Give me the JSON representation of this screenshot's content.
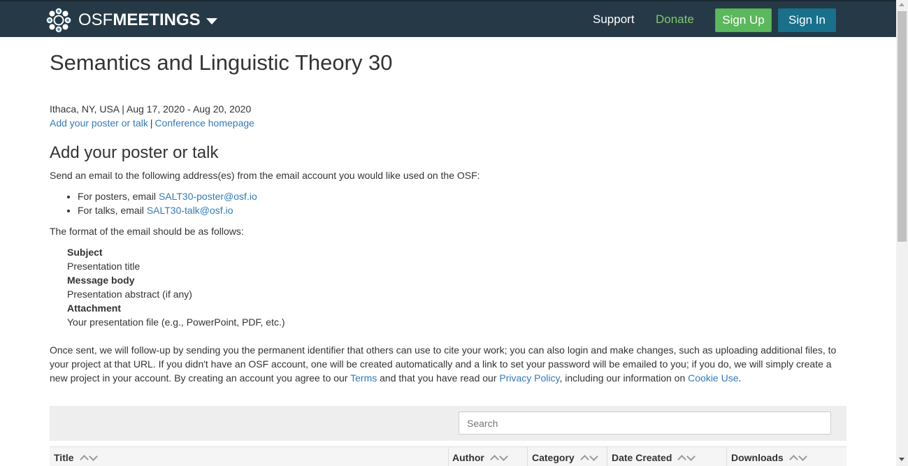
{
  "nav": {
    "brand_osf": "OSF",
    "brand_meetings": "MEETINGS",
    "brand_logo_icon": "osf-flower-logo-icon",
    "support": "Support",
    "donate": "Donate",
    "signup": "Sign Up",
    "signin": "Sign In",
    "colors": {
      "navbar": "#263947",
      "donate": "#7fcb68",
      "signup": "#5cb85c",
      "signin": "#18708b"
    }
  },
  "meeting": {
    "title": "Semantics and Linguistic Theory 30",
    "location_dates": "Ithaca, NY, USA | Aug 17, 2020 - Aug 20, 2020",
    "link_add": "Add your poster or talk",
    "link_sep": "|",
    "link_homepage": "Conference homepage"
  },
  "submit": {
    "heading": "Add your poster or talk",
    "intro": "Send an email to the following address(es) from the email account you would like used on the OSF:",
    "posters_prefix": "For posters, email ",
    "posters_email": "SALT30-poster@osf.io",
    "talks_prefix": "For talks, email ",
    "talks_email": "SALT30-talk@osf.io",
    "format_intro": "The format of the email should be as follows:",
    "subject_label": "Subject",
    "subject_value": "Presentation title",
    "body_label": "Message body",
    "body_value": "Presentation abstract (if any)",
    "attachment_label": "Attachment",
    "attachment_value": "Your presentation file (e.g., PowerPoint, PDF, etc.)",
    "once_sent_1": "Once sent, we will follow-up by sending you the permanent identifier that others can use to cite your work; you can also login and make changes, such as uploading additional files, to your project at that URL. If you didn't have an OSF account, one will be created automatically and a link to set your password will be emailed to you; if you do, we will simply create a new project in your account. By creating an account you agree to our ",
    "terms_link": "Terms",
    "once_sent_2": " and that you have read our ",
    "privacy_link": "Privacy Policy",
    "once_sent_3": ", including our information on ",
    "cookie_link": "Cookie Use",
    "once_sent_4": "."
  },
  "table": {
    "search_placeholder": "Search",
    "columns": [
      "Title",
      "Author",
      "Category",
      "Date Created",
      "Downloads"
    ],
    "sort_icons": [
      "chevron-up-icon",
      "chevron-down-icon"
    ]
  }
}
